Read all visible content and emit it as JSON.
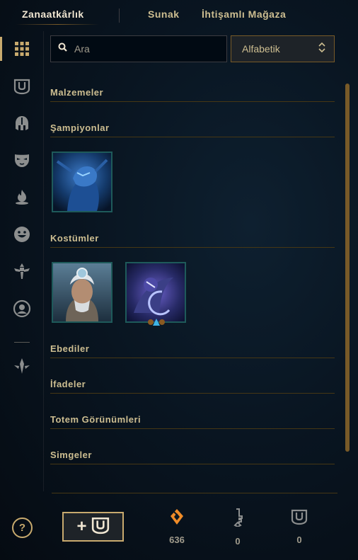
{
  "tabs": [
    {
      "label": "Zanaatkârlık",
      "active": true
    },
    {
      "label": "Sunak",
      "active": false
    },
    {
      "label": "İhtişamlı Mağaza",
      "active": false
    }
  ],
  "rail": {
    "items": [
      "grid-icon",
      "chest-icon",
      "helmet-icon",
      "mask-icon",
      "flame-icon",
      "emote-icon",
      "totem-icon",
      "profile-icon",
      "ward-icon"
    ],
    "active_index": 0
  },
  "search": {
    "placeholder": "Ara",
    "value": ""
  },
  "sort": {
    "label": "Alfabetik"
  },
  "sections": {
    "materials": "Malzemeler",
    "champions": "Şampiyonlar",
    "skins": "Kostümler",
    "eternals": "Ebediler",
    "emotes": "İfadeler",
    "ward_skins": "Totem Görünümleri",
    "icons": "Simgeler"
  },
  "bottom": {
    "help": "?",
    "add_chest_plus": "+",
    "blue_essence": "636",
    "keys": "0",
    "chests": "0"
  },
  "colors": {
    "gold": "#c8aa6e",
    "gold_dark": "#785a28",
    "text_light": "#f0e6d2",
    "tile_border": "#1e5a5a",
    "essence_orange": "#f08c28"
  }
}
